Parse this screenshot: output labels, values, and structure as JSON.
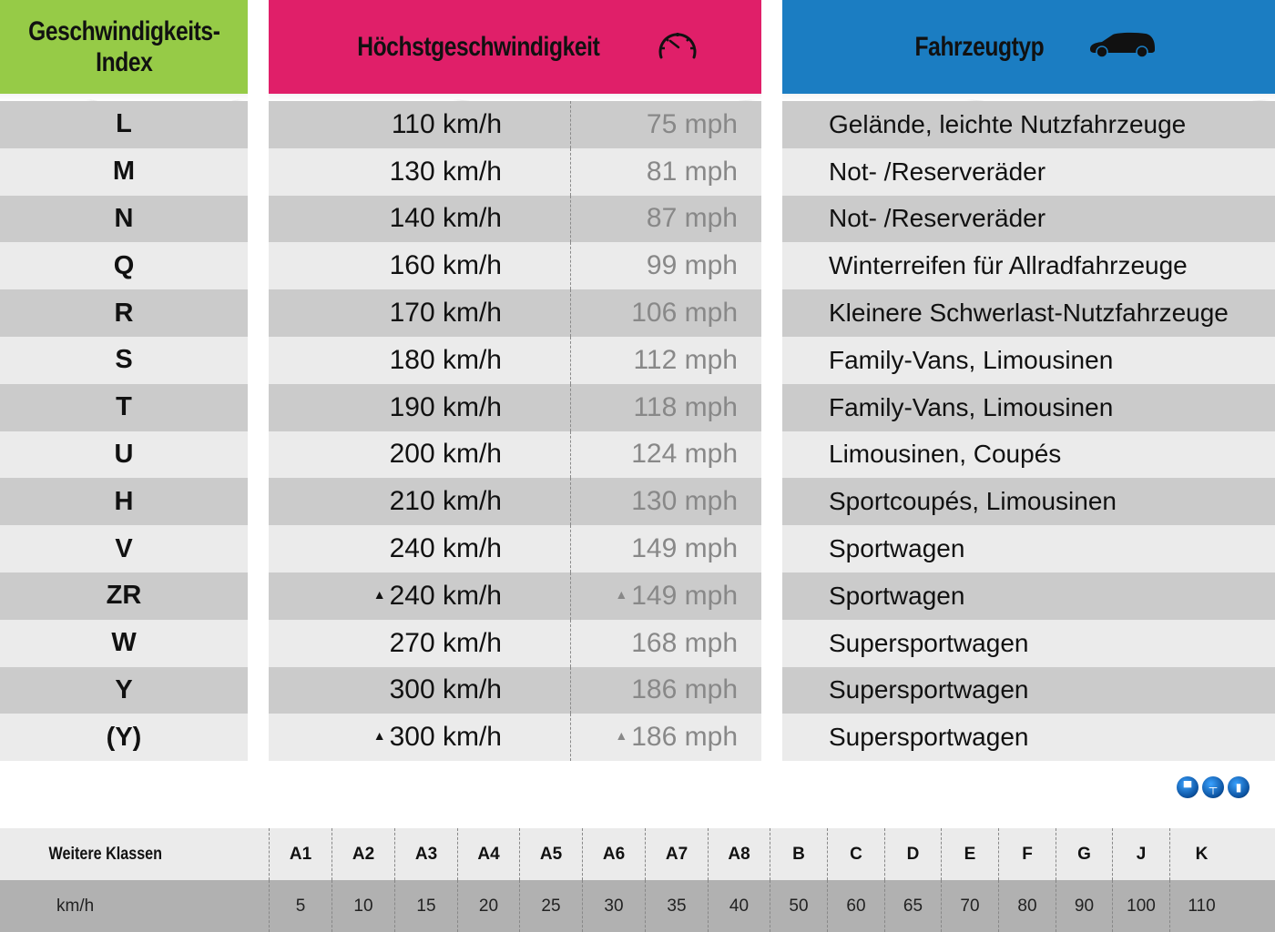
{
  "headers": {
    "index": "Geschwindigkeits-\nIndex",
    "index_line1": "Geschwindigkeits-",
    "index_line2": "Index",
    "speed": "Höchstgeschwindigkeit",
    "vehicle": "Fahrzeugtyp",
    "speed_icon": "speedometer-icon",
    "vehicle_icon": "car-icon"
  },
  "colors": {
    "index_header": "#96cb47",
    "speed_header": "#e01f69",
    "vehicle_header": "#1b7dc2",
    "row_dark": "#cbcbcb",
    "row_light": "#ebebeb",
    "mph_text": "#888888"
  },
  "rows": [
    {
      "index": "L",
      "kmh": "110 km/h",
      "mph": "75 mph",
      "above": false,
      "vehicle": "Gelände, leichte Nutzfahrzeuge"
    },
    {
      "index": "M",
      "kmh": "130 km/h",
      "mph": "81 mph",
      "above": false,
      "vehicle": "Not- /Reserveräder"
    },
    {
      "index": "N",
      "kmh": "140 km/h",
      "mph": "87 mph",
      "above": false,
      "vehicle": "Not- /Reserveräder"
    },
    {
      "index": "Q",
      "kmh": "160 km/h",
      "mph": "99 mph",
      "above": false,
      "vehicle": "Winterreifen für Allradfahrzeuge"
    },
    {
      "index": "R",
      "kmh": "170 km/h",
      "mph": "106 mph",
      "above": false,
      "vehicle": "Kleinere Schwerlast-Nutzfahrzeuge"
    },
    {
      "index": "S",
      "kmh": "180 km/h",
      "mph": "112 mph",
      "above": false,
      "vehicle": "Family-Vans, Limousinen"
    },
    {
      "index": "T",
      "kmh": "190 km/h",
      "mph": "118 mph",
      "above": false,
      "vehicle": "Family-Vans, Limousinen"
    },
    {
      "index": "U",
      "kmh": "200 km/h",
      "mph": "124 mph",
      "above": false,
      "vehicle": "Limousinen, Coupés"
    },
    {
      "index": "H",
      "kmh": "210 km/h",
      "mph": "130 mph",
      "above": false,
      "vehicle": "Sportcoupés, Limousinen"
    },
    {
      "index": "V",
      "kmh": "240 km/h",
      "mph": "149 mph",
      "above": false,
      "vehicle": "Sportwagen"
    },
    {
      "index": "ZR",
      "kmh": "240 km/h",
      "mph": "149 mph",
      "above": true,
      "vehicle": "Sportwagen"
    },
    {
      "index": "W",
      "kmh": "270 km/h",
      "mph": "168 mph",
      "above": false,
      "vehicle": "Supersportwagen"
    },
    {
      "index": "Y",
      "kmh": "300 km/h",
      "mph": "186 mph",
      "above": false,
      "vehicle": "Supersportwagen"
    },
    {
      "index": "(Y)",
      "kmh": "300 km/h",
      "mph": "186 mph",
      "above": true,
      "vehicle": "Supersportwagen"
    }
  ],
  "above_marker": "▲",
  "logo_icons": [
    "car-icon",
    "piston-icon",
    "oil-bottle-icon"
  ],
  "extra_classes": {
    "header_label": "Weitere Klassen",
    "value_label": "km/h",
    "classes": [
      "A1",
      "A2",
      "A3",
      "A4",
      "A5",
      "A6",
      "A7",
      "A8",
      "B",
      "C",
      "D",
      "E",
      "F",
      "G",
      "J",
      "K"
    ],
    "values": [
      "5",
      "10",
      "15",
      "20",
      "25",
      "30",
      "35",
      "40",
      "50",
      "60",
      "65",
      "70",
      "80",
      "90",
      "100",
      "110"
    ]
  }
}
